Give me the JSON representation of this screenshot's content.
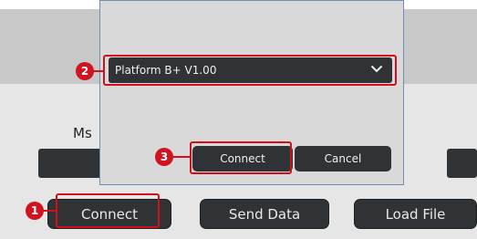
{
  "background": {
    "msg_label": "Ms"
  },
  "main_buttons": {
    "connect": "Connect",
    "send_data": "Send Data",
    "load_file": "Load File"
  },
  "dialog": {
    "platform_select": {
      "value": "Platform B+ V1.00"
    },
    "connect_label": "Connect",
    "cancel_label": "Cancel"
  },
  "callouts": {
    "one": "1",
    "two": "2",
    "three": "3"
  },
  "colors": {
    "highlight": "#d0111b",
    "button_bg": "#2f3335",
    "band": "#c8c8c8",
    "dialog_bg": "#d9d9d9"
  }
}
